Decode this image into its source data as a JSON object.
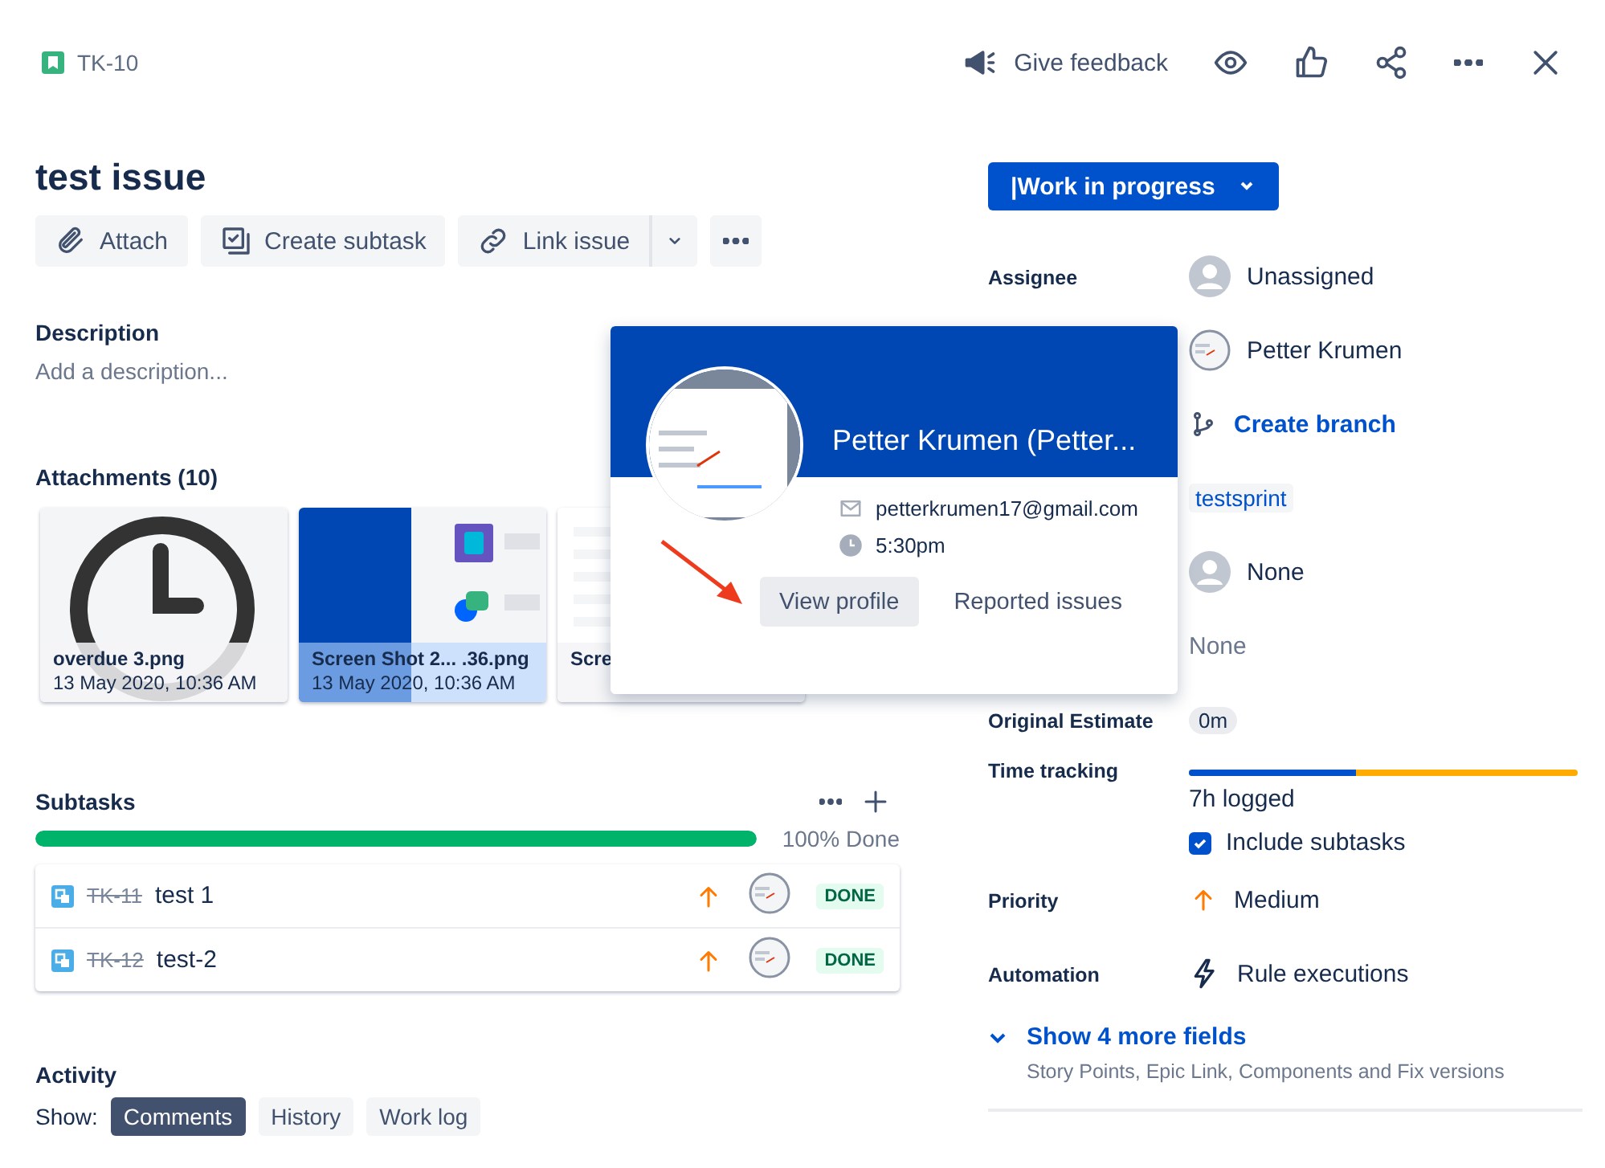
{
  "header": {
    "issue_key": "TK-10",
    "feedback": "Give feedback"
  },
  "title": "test issue",
  "actions": [
    {
      "label": "Attach"
    },
    {
      "label": "Create subtask"
    },
    {
      "label": "Link issue"
    }
  ],
  "description": {
    "heading": "Description",
    "placeholder": "Add a description..."
  },
  "attachments": {
    "heading": "Attachments (10)",
    "items": [
      {
        "kind": "clock",
        "name": "overdue 3.png",
        "date": "13 May 2020, 10:36 AM",
        "selected": false
      },
      {
        "kind": "screenshot",
        "name": "Screen Shot 2...  .36.png",
        "date": "13 May 2020, 10:36 AM",
        "selected": true
      },
      {
        "kind": "blank",
        "name": "Scre",
        "selected": false
      }
    ]
  },
  "subtasks": {
    "heading": "Subtasks",
    "level": 1,
    "progress_label": "100% Done",
    "items": [
      {
        "key": "TK-11",
        "summary": "test 1",
        "status": "DONE"
      },
      {
        "key": "TK-12",
        "summary": "test-2",
        "status": "DONE"
      }
    ]
  },
  "activity": {
    "heading": "Activity",
    "show_label": "Show:",
    "filters": [
      {
        "label": "Comments",
        "selected": true
      },
      {
        "label": "History",
        "selected": false
      },
      {
        "label": "Work log",
        "selected": false
      }
    ]
  },
  "status": {
    "label": "|Work in progress"
  },
  "fields": [
    {
      "label": "Assignee",
      "kind": "avatar",
      "value": "Unassigned"
    },
    {
      "value": "Petter Krumen"
    },
    {
      "kind": "branch",
      "value": "Create branch"
    },
    {
      "kind": "tag",
      "value": "testsprint"
    },
    {
      "kind": "avatar",
      "value": "None"
    },
    {
      "kind": "muted",
      "value": "None"
    },
    {
      "label": "Original Estimate",
      "kind": "lozenge",
      "value": "0m"
    },
    {
      "label": "Time tracking",
      "kind": "time",
      "level": 0.43,
      "value": "7h logged",
      "checkbox": {
        "label": "Include subtasks",
        "checked": true
      }
    },
    {
      "label": "Priority",
      "kind": "priority",
      "value": "Medium"
    },
    {
      "label": "Automation",
      "kind": "automation",
      "value": "Rule executions"
    }
  ],
  "more_fields": {
    "label": "Show 4 more fields",
    "hint": "Story Points, Epic Link, Components and Fix versions"
  },
  "popover": {
    "name": "Petter Krumen (Petter...",
    "email": "petterkrumen17@gmail.com",
    "time": "5:30pm",
    "buttons": [
      {
        "label": "View profile",
        "selected": true
      },
      {
        "label": "Reported issues",
        "selected": false
      }
    ]
  }
}
